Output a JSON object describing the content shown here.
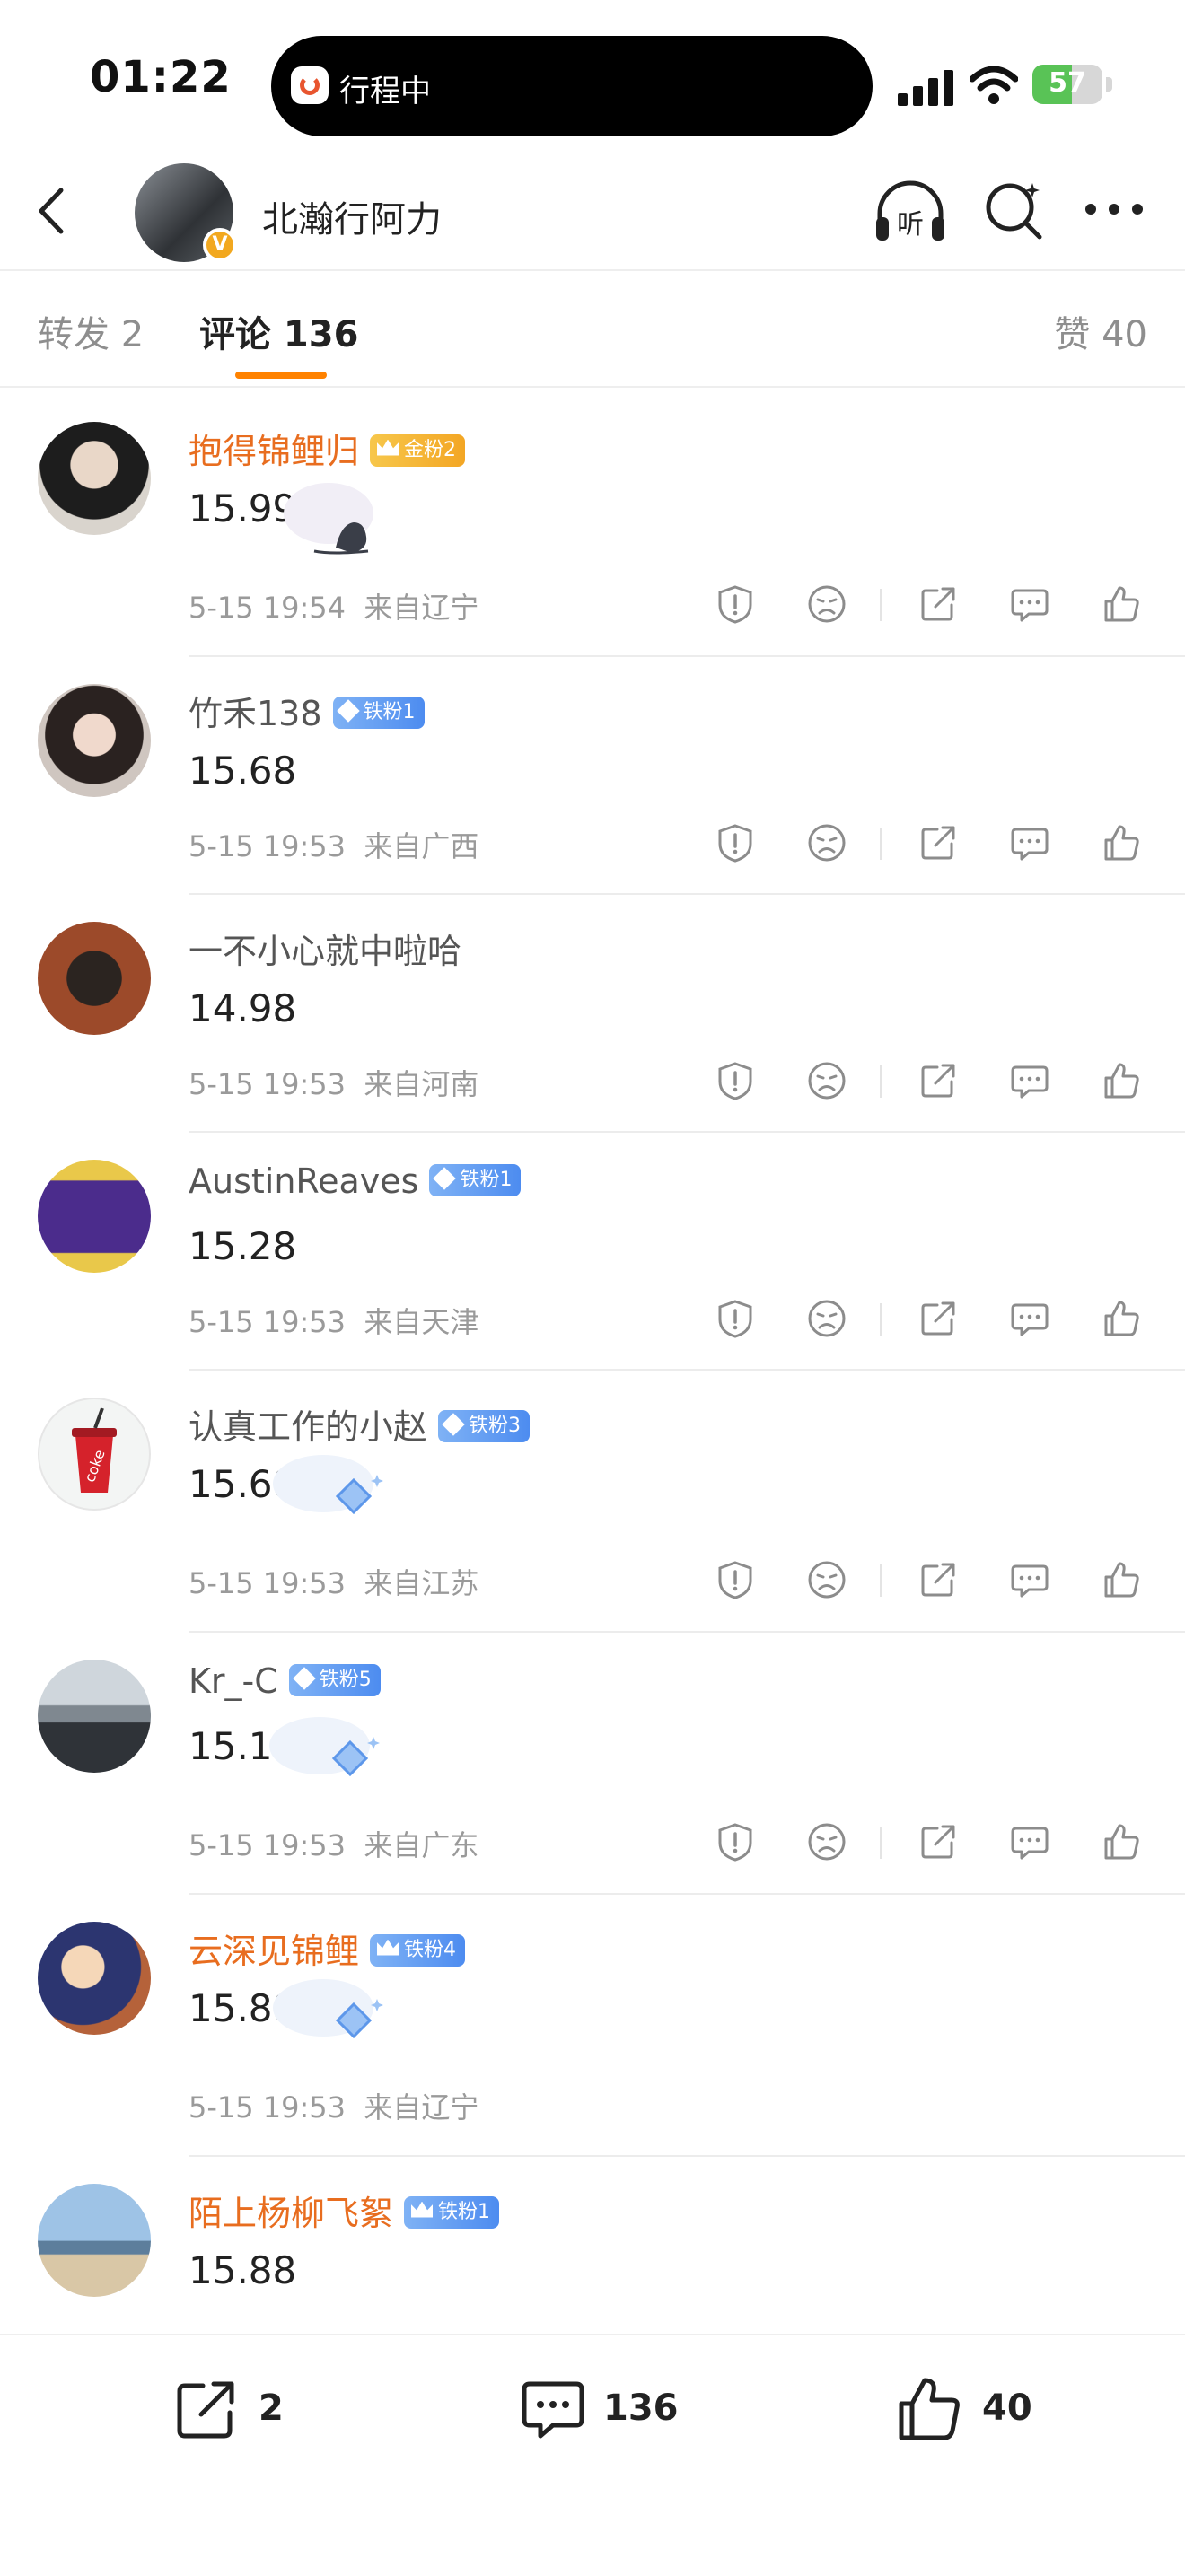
{
  "status_bar": {
    "time": "01:22",
    "island_label": "行程中",
    "battery": "57",
    "battery_level": 0.57
  },
  "header": {
    "title": "北瀚行阿力",
    "verified_badge": "V"
  },
  "tabs": {
    "repost": "转发 2",
    "comments": "评论 136",
    "likes": "赞 40"
  },
  "comments": [
    {
      "name": "抱得锦鲤归",
      "name_style": "vip",
      "badge": "金粉2",
      "badge_style": "gold",
      "text": "15.99",
      "time": "5-15 19:54",
      "location": "来自辽宁",
      "deco": "cloud-sticker",
      "has_actions": true
    },
    {
      "name": "竹禾138",
      "name_style": "normal",
      "badge": "铁粉1",
      "badge_style": "blue",
      "text": "15.68",
      "time": "5-15 19:53",
      "location": "来自广西",
      "has_actions": true
    },
    {
      "name": "一不小心就中啦哈",
      "name_style": "normal",
      "badge": "",
      "text": "14.98",
      "time": "5-15 19:53",
      "location": "来自河南",
      "has_actions": true
    },
    {
      "name": "AustinReaves",
      "name_style": "normal",
      "badge": "铁粉1",
      "badge_style": "blue",
      "text": "15.28",
      "time": "5-15 19:53",
      "location": "来自天津",
      "has_actions": true
    },
    {
      "name": "认真工作的小赵",
      "name_style": "normal",
      "badge": "铁粉3",
      "badge_style": "blue",
      "text": "15.68",
      "time": "5-15 19:53",
      "location": "来自江苏",
      "deco": "diamond",
      "has_actions": true
    },
    {
      "name": "Kr_-C",
      "name_style": "normal",
      "badge": "铁粉5",
      "badge_style": "blue",
      "text": "15.18",
      "time": "5-15 19:53",
      "location": "来自广东",
      "deco": "diamond",
      "has_actions": true
    },
    {
      "name": "云深见锦鲤",
      "name_style": "vip",
      "badge": "铁粉4",
      "badge_style": "blue",
      "crown": true,
      "text": "15.88",
      "time": "5-15 19:53",
      "location": "来自辽宁",
      "deco": "diamond",
      "has_actions": false
    },
    {
      "name": "陌上杨柳飞絮",
      "name_style": "vip",
      "badge": "铁粉1",
      "badge_style": "blue",
      "crown": true,
      "text": "15.88",
      "time": "",
      "location": "",
      "has_actions": false
    }
  ],
  "bottom_bar": {
    "repost_count": "2",
    "comment_count": "136",
    "like_count": "40"
  },
  "colors": {
    "accent": "#ff8200",
    "vip_name": "#e86d1f",
    "meta": "#9a9a9a"
  }
}
